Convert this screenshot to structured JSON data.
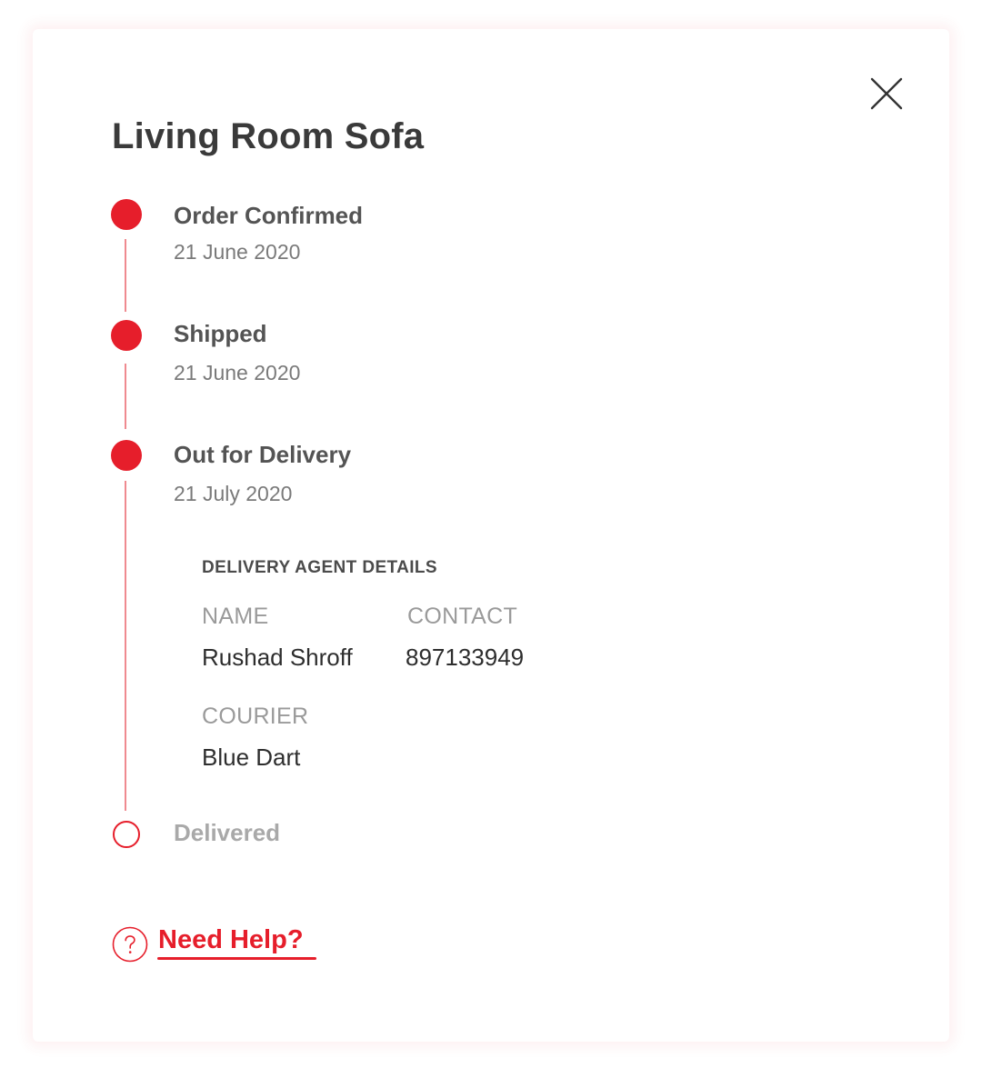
{
  "product_title": "Living Room Sofa",
  "accent_color": "#e61e2b",
  "close_icon": "close-icon",
  "timeline": [
    {
      "status": "Order Confirmed",
      "date": "21 June 2020",
      "state": "complete"
    },
    {
      "status": "Shipped",
      "date": "21 June 2020",
      "state": "complete"
    },
    {
      "status": "Out for Delivery",
      "date": "21 July 2020",
      "state": "complete"
    },
    {
      "status": "Delivered",
      "date": "",
      "state": "pending"
    }
  ],
  "agent": {
    "heading": "DELIVERY AGENT DETAILS",
    "name_label": "NAME",
    "name_value": "Rushad Shroff",
    "contact_label": "CONTACT",
    "contact_value": "897133949",
    "courier_label": "COURIER",
    "courier_value": "Blue Dart"
  },
  "help": {
    "icon": "question-circle-icon",
    "label": "Need Help?"
  }
}
